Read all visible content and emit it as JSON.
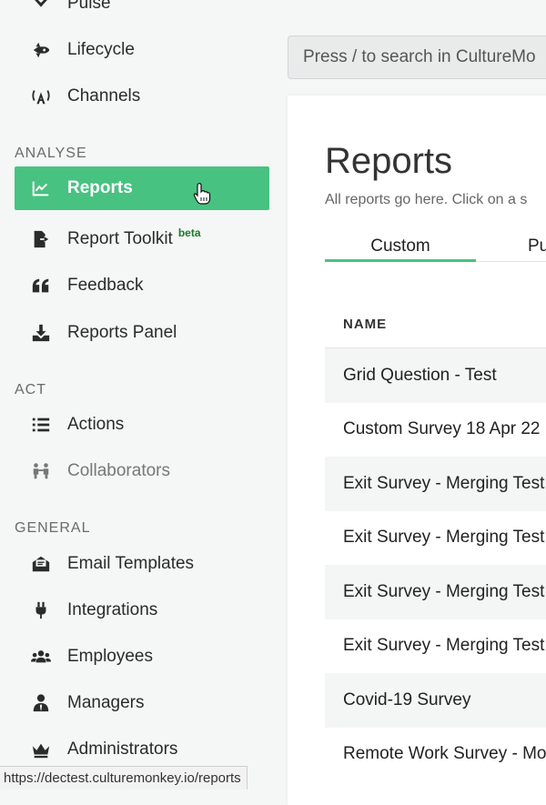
{
  "sidebar": {
    "top_items": [
      {
        "label": "Pulse",
        "icon": "pulse-icon"
      },
      {
        "label": "Lifecycle",
        "icon": "rocket-icon"
      },
      {
        "label": "Channels",
        "icon": "broadcast-icon"
      }
    ],
    "sections": [
      {
        "title": "ANALYSE",
        "items": [
          {
            "label": "Reports",
            "icon": "chart-line-icon",
            "active": true
          },
          {
            "label": "Report Toolkit",
            "badge": "beta",
            "icon": "file-export-icon"
          },
          {
            "label": "Feedback",
            "icon": "quote-icon"
          },
          {
            "label": "Reports Panel",
            "icon": "download-icon"
          }
        ]
      },
      {
        "title": "ACT",
        "items": [
          {
            "label": "Actions",
            "icon": "list-icon"
          },
          {
            "label": "Collaborators",
            "icon": "collaborators-icon",
            "muted": true
          }
        ]
      },
      {
        "title": "GENERAL",
        "items": [
          {
            "label": "Email Templates",
            "icon": "email-template-icon"
          },
          {
            "label": "Integrations",
            "icon": "plug-icon"
          },
          {
            "label": "Employees",
            "icon": "users-icon"
          },
          {
            "label": "Managers",
            "icon": "manager-icon"
          },
          {
            "label": "Administrators",
            "icon": "crown-icon"
          }
        ]
      }
    ]
  },
  "search": {
    "placeholder": "Press / to search in CultureMo"
  },
  "main": {
    "title": "Reports",
    "subtitle": "All reports go here. Click on a s",
    "tabs": [
      {
        "label": "Custom",
        "active": true
      },
      {
        "label": "Pu"
      }
    ],
    "table": {
      "header": "NAME",
      "rows": [
        "Grid Question - Test",
        "Custom Survey 18 Apr 22",
        "Exit Survey - Merging Test",
        "Exit Survey - Merging Test",
        "Exit Survey - Merging Test",
        "Exit Survey - Merging Test",
        "Covid-19 Survey",
        "Remote Work Survey - Mo"
      ]
    }
  },
  "status_bar": {
    "url": "https://dectest.culturemonkey.io/reports"
  },
  "colors": {
    "accent": "#47c280",
    "badge": "#1a7a2a"
  }
}
